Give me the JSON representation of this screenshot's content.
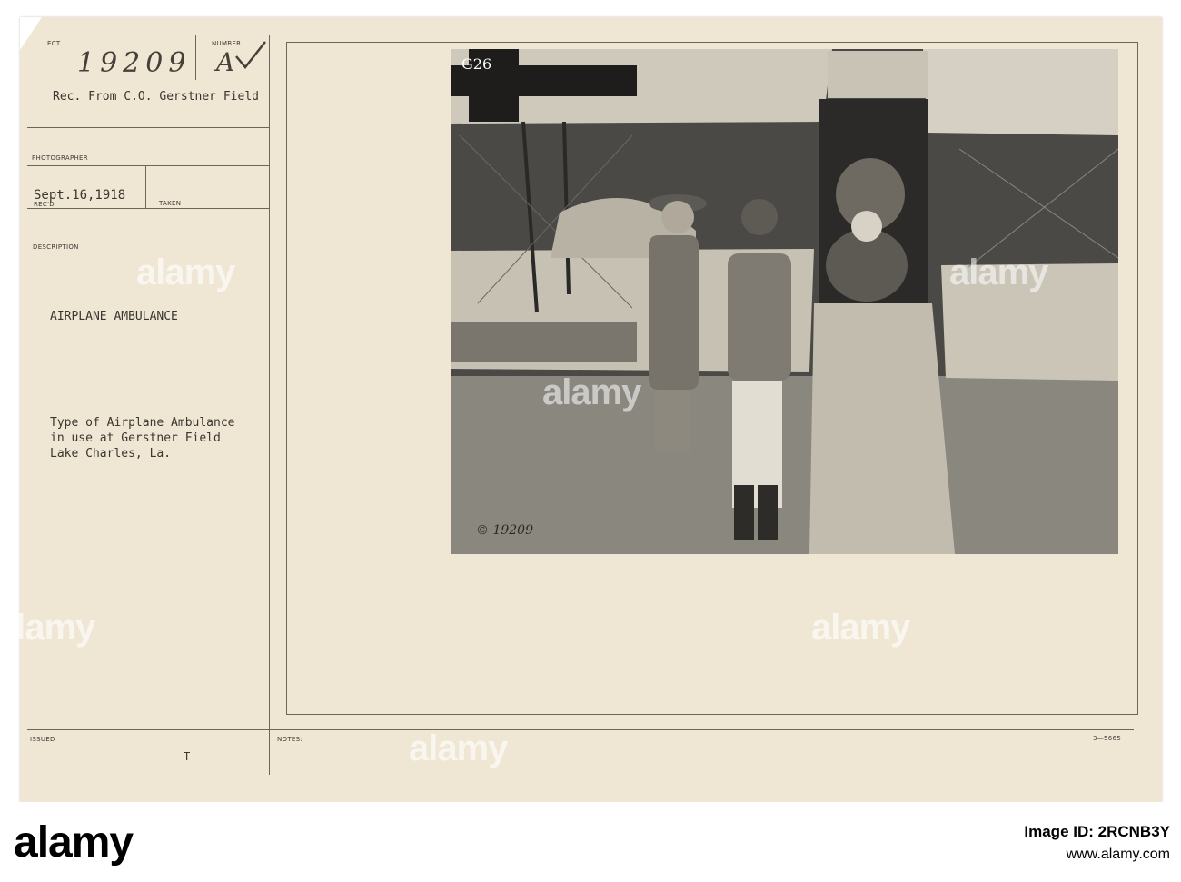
{
  "card": {
    "labels": {
      "subject": "ECT",
      "number": "NUMBER",
      "photographer": "PHOTOGRAPHER",
      "recd": "REC'D",
      "taken": "TAKEN",
      "description": "DESCRIPTION",
      "issued": "ISSUED",
      "notes": "NOTES:"
    },
    "subject_number": "19209",
    "number_letter": "A",
    "received_from": "Rec. From C.O. Gerstner Field",
    "date": "Sept.16,1918",
    "title": "AIRPLANE AMBULANCE",
    "description_lines": [
      "Type of Airplane Ambulance",
      "in use at Gerstner Field",
      "Lake Charles, La."
    ],
    "issued_mark": "T",
    "form_code": "3—5665"
  },
  "photo": {
    "plane_marking": "G26",
    "negative_number": "© 19209"
  },
  "watermark": "alamy",
  "footer": {
    "logo": "alamy",
    "image_id_label": "Image ID: 2RCNB3Y",
    "site": "www.alamy.com"
  },
  "colors": {
    "card": "#efe6d4",
    "ink": "#3a3630",
    "photo": "#3b3a37"
  }
}
